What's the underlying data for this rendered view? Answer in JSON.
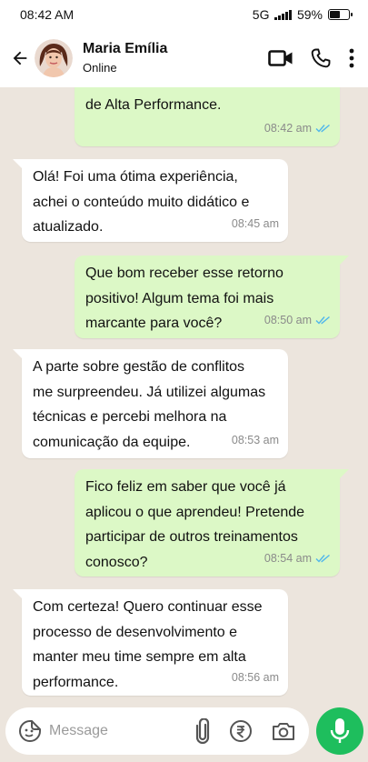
{
  "status_bar": {
    "time": "08:42 AM",
    "network": "5G",
    "battery": "59%",
    "battery_level": 0.59
  },
  "header": {
    "contact_name": "Maria Emília",
    "presence": "Online",
    "icons": [
      "back-arrow-icon",
      "video-call-icon",
      "phone-icon",
      "more-vert-icon"
    ]
  },
  "messages": [
    {
      "direction": "out",
      "text": "em Liderança e Gestão de Equipes\nde Alta Performance.",
      "time": "08:42 am",
      "status": "read"
    },
    {
      "direction": "in",
      "text": "Olá! Foi uma ótima experiência,\nachei o conteúdo muito didático e\natualizado.",
      "time": "08:45 am"
    },
    {
      "direction": "out",
      "text": "Que bom receber esse retorno\npositivo! Algum tema foi mais\nmarcante para você?",
      "time": "08:50 am",
      "status": "read"
    },
    {
      "direction": "in",
      "text": "A parte sobre gestão de conflitos\nme surpreendeu. Já utilizei algumas\ntécnicas e percebi melhora na\ncomunicação da equipe.",
      "time": "08:53 am"
    },
    {
      "direction": "out",
      "text": "Fico feliz em saber que você já\naplicou o que aprendeu! Pretende\nparticipar de outros treinamentos\nconosco?",
      "time": "08:54 am",
      "status": "read"
    },
    {
      "direction": "in",
      "text": "Com certeza! Quero continuar esse\nprocesso de desenvolvimento e\nmanter meu time sempre em alta\nperformance.",
      "time": "08:56 am"
    }
  ],
  "composer": {
    "placeholder": "Message",
    "icons": [
      "sticker-icon",
      "attach-icon",
      "rupee-payment-icon",
      "camera-icon",
      "mic-icon"
    ]
  },
  "colors": {
    "background": "#ece5dd",
    "outgoing_bubble": "#dcf8c6",
    "incoming_bubble": "#ffffff",
    "read_ticks": "#4fb6ec",
    "mic_button": "#1ebe5d"
  }
}
